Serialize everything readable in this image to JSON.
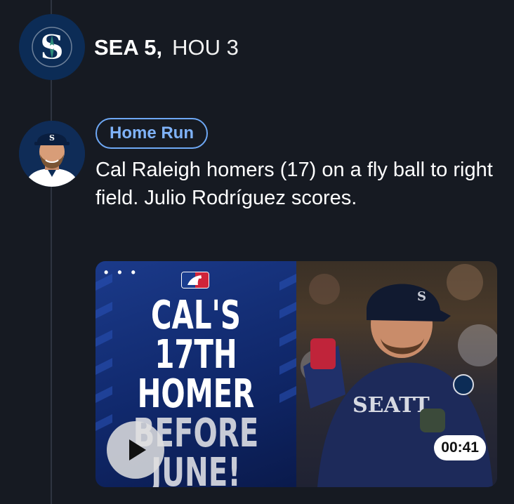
{
  "header": {
    "team_logo_icon": "mariners-logo-icon",
    "score_leader": "SEA 5,",
    "score_trailer": "HOU 3"
  },
  "event": {
    "player_avatar_icon": "cal-raleigh-headshot",
    "badge_label": "Home Run",
    "description": "Cal Raleigh homers (17) on a fly ball to right field. Julio Rodríguez scores."
  },
  "media": {
    "promo_lines": [
      "CAL'S 17TH",
      "HOMER",
      "BEFORE",
      "JUNE!"
    ],
    "menu_icon": "more-dots-icon",
    "brand_icon": "mlb-logo-icon",
    "play_icon": "play-icon",
    "duration": "00:41"
  },
  "colors": {
    "background": "#161a22",
    "badge_accent": "#6ea8f5",
    "mariners_navy": "#0c2c56"
  }
}
